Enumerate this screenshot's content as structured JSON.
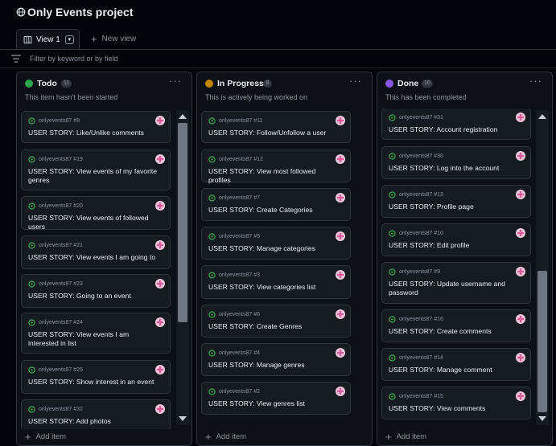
{
  "project": {
    "title": "Only Events project"
  },
  "views": {
    "active": "View 1",
    "new_view": "New view"
  },
  "filter": {
    "placeholder": "Filter by keyword or by field"
  },
  "colors": {
    "todo": "#2da44e",
    "in_progress": "#bf8700",
    "done": "#8957e5"
  },
  "columns": [
    {
      "name": "Todo",
      "count": "11",
      "description": "This item hasn't been started",
      "add_label": "Add item",
      "scroll_position": 0.0,
      "cards": [
        {
          "meta": "onlyevents87 #8",
          "title": "USER STORY: Like/Unlike comments"
        },
        {
          "meta": "onlyevents87 #19",
          "title": "USER STORY: View events of my favorite genres"
        },
        {
          "meta": "onlyevents87 #20",
          "title": "USER STORY: View events of followed users"
        },
        {
          "meta": "onlyevents87 #21",
          "title": "USER STORY: View events I am going to"
        },
        {
          "meta": "onlyevents87 #23",
          "title": "USER STORY: Going to an event"
        },
        {
          "meta": "onlyevents87 #24",
          "title": "USER STORY: View events I am interested in list"
        },
        {
          "meta": "onlyevents87 #25",
          "title": "USER STORY: Show interest in an event"
        },
        {
          "meta": "onlyevents87 #32",
          "title": "USER STORY: Add photos"
        }
      ]
    },
    {
      "name": "In Progress",
      "count": "8",
      "description": "This is actively being worked on",
      "add_label": "Add item",
      "cards": [
        {
          "meta": "onlyevents87 #11",
          "title": "USER STORY: Follow/Unfollow a user"
        },
        {
          "meta": "onlyevents87 #12",
          "title": "USER STORY: View most followed profiles"
        },
        {
          "meta": "onlyevents87 #7",
          "title": "USER STORY: Create Categories"
        },
        {
          "meta": "onlyevents87 #5",
          "title": "USER STORY: Manage categories"
        },
        {
          "meta": "onlyevents87 #3",
          "title": "USER STORY: View categories list"
        },
        {
          "meta": "onlyevents87 #6",
          "title": "USER STORY: Create Genres"
        },
        {
          "meta": "onlyevents87 #4",
          "title": "USER STORY: Manage genres"
        },
        {
          "meta": "onlyevents87 #2",
          "title": "USER STORY: View genres list"
        }
      ]
    },
    {
      "name": "Done",
      "count": "16",
      "description": "This has been completed",
      "add_label": "Add item",
      "scroll_position": 1.0,
      "cards": [
        {
          "meta": "onlyevents87 #31",
          "title": "USER STORY: Account registration"
        },
        {
          "meta": "onlyevents87 #30",
          "title": "USER STORY: Log into the account"
        },
        {
          "meta": "onlyevents87 #13",
          "title": "USER STORY: Profile page"
        },
        {
          "meta": "onlyevents87 #10",
          "title": "USER STORY: Edit profile"
        },
        {
          "meta": "onlyevents87 #9",
          "title": "USER STORY: Update username and password"
        },
        {
          "meta": "onlyevents87 #16",
          "title": "USER STORY: Create comments"
        },
        {
          "meta": "onlyevents87 #14",
          "title": "USER STORY: Manage comment"
        },
        {
          "meta": "onlyevents87 #15",
          "title": "USER STORY: View comments"
        }
      ]
    }
  ]
}
